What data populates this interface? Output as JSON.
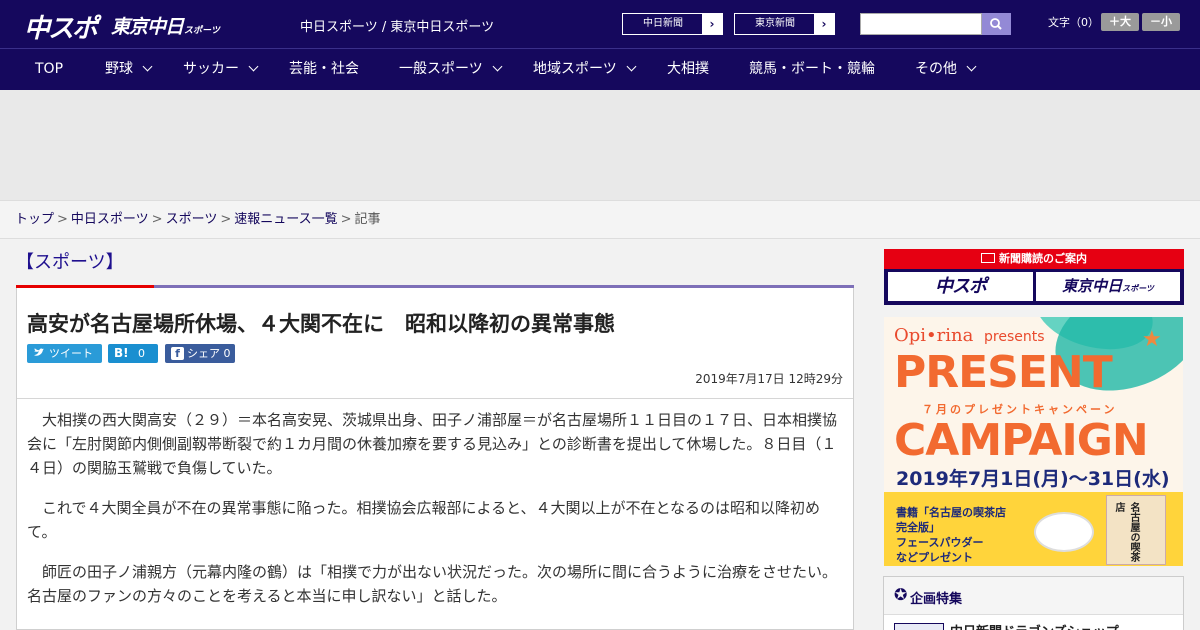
{
  "header": {
    "logo_chuspo": "中スポ",
    "logo_tokyo": "東京中日",
    "logo_tokyo_sub": "スポーツ",
    "site_names": "中日スポーツ / 東京中日スポーツ",
    "ext_links": [
      {
        "label": "中日新聞",
        "arrow": "›"
      },
      {
        "label": "東京新聞",
        "arrow": "›"
      }
    ],
    "search_placeholder": "",
    "font_size_label": "文字（0）",
    "font_larger": "＋大",
    "font_smaller": "－小"
  },
  "nav": {
    "items": [
      {
        "label": "TOP",
        "dropdown": false
      },
      {
        "label": "野球",
        "dropdown": true
      },
      {
        "label": "サッカー",
        "dropdown": true
      },
      {
        "label": "芸能・社会",
        "dropdown": false
      },
      {
        "label": "一般スポーツ",
        "dropdown": true
      },
      {
        "label": "地域スポーツ",
        "dropdown": true
      },
      {
        "label": "大相撲",
        "dropdown": false
      },
      {
        "label": "競馬・ボート・競輪",
        "dropdown": false
      },
      {
        "label": "その他",
        "dropdown": true
      }
    ]
  },
  "breadcrumb": {
    "items": [
      "トップ",
      "中日スポーツ",
      "スポーツ",
      "速報ニュース一覧"
    ],
    "current": "記事",
    "separator": ">"
  },
  "article": {
    "category": "【スポーツ】",
    "headline": "高安が名古屋場所休場、４大関不在に　昭和以降初の異常事態",
    "share": {
      "tweet": "ツイート",
      "hatena_icon": "B!",
      "hatena_count": "0",
      "facebook_label": "シェア",
      "facebook_count": "0"
    },
    "date": "2019年7月17日 12時29分",
    "paragraphs": [
      "大相撲の西大関高安（２９）＝本名高安晃、茨城県出身、田子ノ浦部屋＝が名古屋場所１１日目の１７日、日本相撲協会に「左肘関節内側側副靱帯断裂で約１カ月間の休養加療を要する見込み」との診断書を提出して休場した。８日目（１４日）の関脇玉鷲戦で負傷していた。",
      "これで４大関全員が不在の異常事態に陥った。相撲協会広報部によると、４大関以上が不在となるのは昭和以降初めて。",
      "師匠の田子ノ浦親方（元幕内隆の鶴）は「相撲で力が出ない状況だった。次の場所に間に合うように治療をさせたい。名古屋のファンの方々のことを考えると本当に申し訳ない」と話した。"
    ]
  },
  "sidebar": {
    "subscription_title": "新聞購読のご案内",
    "sub_chuspo": "中スポ",
    "sub_tokyo": "東京中日",
    "sub_tokyo_small": "スポーツ",
    "promo": {
      "brand": "Opi•rina",
      "presents": "presents",
      "line1": "PRESENT",
      "line2": "７月のプレゼントキャンペーン",
      "line3": "CAMPAIGN",
      "period": "2019年7月1日(月)〜31日(水)",
      "product_line1": "書籍「名古屋の喫茶店",
      "product_line2": "完全版」",
      "product_line3": "フェースパウダー",
      "product_line4": "などプレゼント",
      "package": "名古屋の喫茶店"
    },
    "feature_title": "企画特集",
    "feature_item": "中日新聞ドラゴンズショップ"
  },
  "colors": {
    "header_bg": "#15085d",
    "accent_red": "#e60000",
    "rule_purple": "#7e70b8",
    "promo_orange": "#f26a30"
  }
}
